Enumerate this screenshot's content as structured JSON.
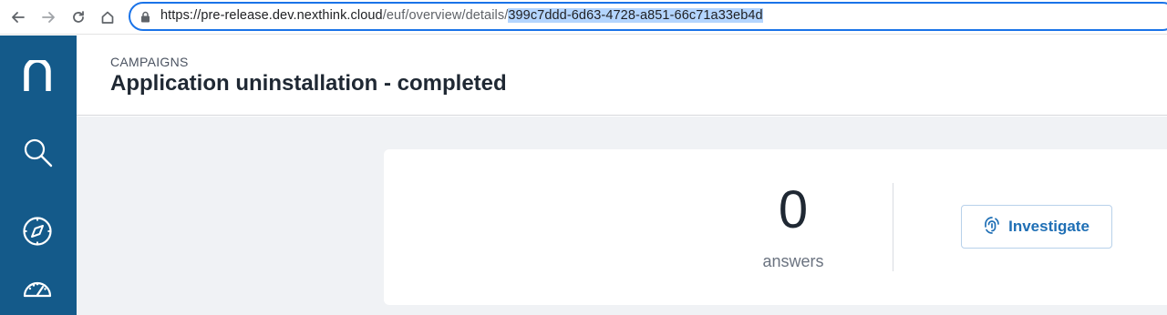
{
  "browser": {
    "url_host": "https://pre-release.dev.nexthink.cloud",
    "url_path": "/euf/overview/details/",
    "url_selected": "399c7ddd-6d63-4728-a851-66c71a33eb4d"
  },
  "header": {
    "breadcrumb": "CAMPAIGNS",
    "title": "Application uninstallation - completed"
  },
  "summary": {
    "count": "0",
    "count_label": "answers",
    "investigate_label": "Investigate"
  },
  "colors": {
    "nav_background": "#145a8a",
    "accent": "#1f6fb5",
    "page_background": "#f0f2f5"
  },
  "icons": {
    "nav": [
      "nexthink-logo-icon",
      "search-icon",
      "compass-icon",
      "gauge-icon"
    ],
    "browser": [
      "back-icon",
      "forward-icon",
      "reload-icon",
      "home-icon",
      "lock-icon"
    ],
    "button": "investigate-icon"
  }
}
